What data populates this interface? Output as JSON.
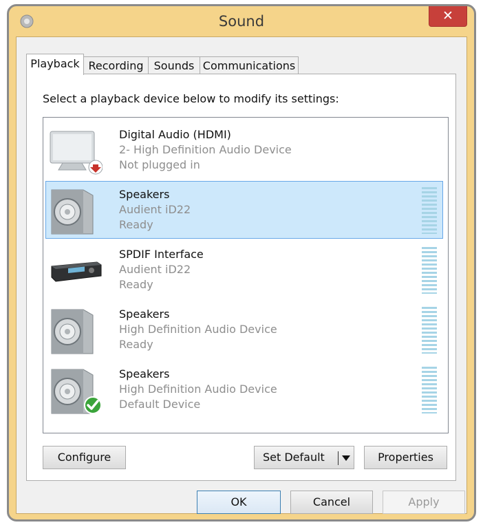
{
  "window": {
    "title": "Sound",
    "close_label": "✕",
    "colors": {
      "frame": "#f5d48a",
      "close": "#c7403a",
      "selection": "#cde8fb",
      "selection_border": "#66a7e8",
      "meter": "#a6d4e6"
    }
  },
  "tabs": [
    {
      "label": "Playback",
      "active": true
    },
    {
      "label": "Recording",
      "active": false
    },
    {
      "label": "Sounds",
      "active": false
    },
    {
      "label": "Communications",
      "active": false
    }
  ],
  "playback": {
    "instruction": "Select a playback device below to modify its settings:",
    "devices": [
      {
        "name": "Digital Audio (HDMI)",
        "description": "2- High Definition Audio Device",
        "status": "Not plugged in",
        "icon": "monitor-icon",
        "badge": "unplugged-badge-icon",
        "meter": false,
        "selected": false
      },
      {
        "name": "Speakers",
        "description": "Audient iD22",
        "status": "Ready",
        "icon": "speaker-icon",
        "badge": null,
        "meter": true,
        "selected": true
      },
      {
        "name": "SPDIF Interface",
        "description": "Audient iD22",
        "status": "Ready",
        "icon": "spdif-receiver-icon",
        "badge": null,
        "meter": true,
        "selected": false
      },
      {
        "name": "Speakers",
        "description": "High Definition Audio Device",
        "status": "Ready",
        "icon": "speaker-icon",
        "badge": null,
        "meter": true,
        "selected": false
      },
      {
        "name": "Speakers",
        "description": "High Definition Audio Device",
        "status": "Default Device",
        "icon": "speaker-icon",
        "badge": "default-check-icon",
        "meter": true,
        "selected": false
      }
    ],
    "configure_label": "Configure",
    "set_default_label": "Set Default",
    "properties_label": "Properties"
  },
  "footer": {
    "ok_label": "OK",
    "cancel_label": "Cancel",
    "apply_label": "Apply"
  }
}
